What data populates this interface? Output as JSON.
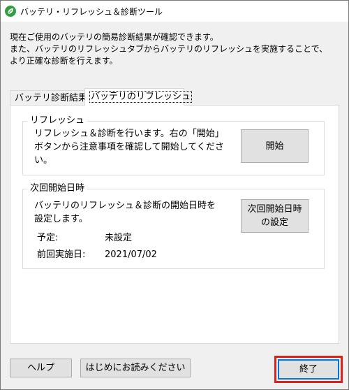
{
  "window": {
    "title": "バッテリ・リフレッシュ＆診断ツール",
    "icon": "green-leaf-app-icon"
  },
  "intro": {
    "lines": [
      "現在ご使用のバッテリの簡易診断結果が確認できます。",
      "また、バッテリのリフレッシュタブからバッテリのリフレッシュを実施することで、",
      "より正確な診断を行えます。"
    ]
  },
  "tabs": [
    {
      "label": "バッテリ診断結果",
      "active": false
    },
    {
      "label": "バッテリのリフレッシュ",
      "active": true
    }
  ],
  "refresh_group": {
    "legend": "リフレッシュ",
    "lines": [
      "リフレッシュ＆診断を行います。右の「開始」",
      "ボタンから注意事項を確認して開始してくださ",
      "い。"
    ],
    "start_button": "開始"
  },
  "schedule_group": {
    "legend": "次回開始日時",
    "lines": [
      "バッテリのリフレッシュ＆診断の開始日時を",
      "設定します。"
    ],
    "set_button_lines": [
      "次回開始日時",
      "の設定"
    ],
    "scheduled_label": "予定:",
    "scheduled_value": "未設定",
    "last_run_label": "前回実施日:",
    "last_run_value": "2021/07/02"
  },
  "footer": {
    "help_button": "ヘルプ",
    "readme_button": "はじめにお読みください",
    "close_button": "終了"
  },
  "colors": {
    "highlight": "#e0201a",
    "focus_border": "#0078d7",
    "app_icon": "#2e9e3e"
  }
}
